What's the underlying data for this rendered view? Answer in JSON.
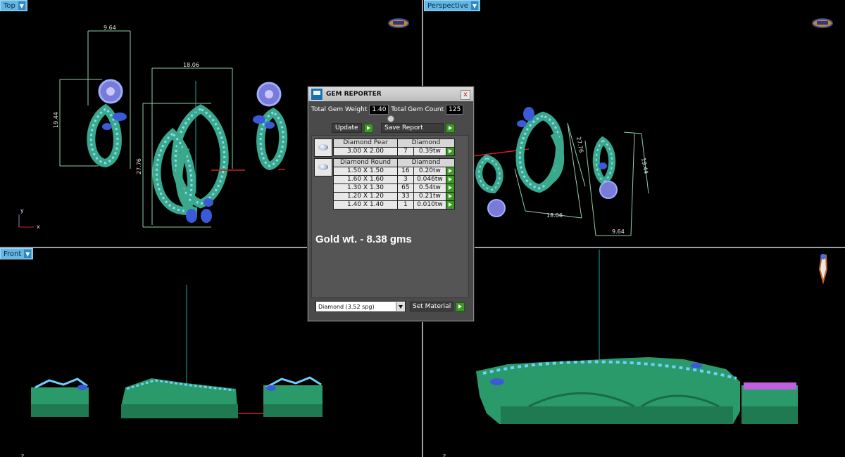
{
  "viewports": {
    "top": {
      "label": "Top",
      "dims": {
        "w1": "9.64",
        "h1": "19.44",
        "w2": "18.06",
        "h2": "27.76"
      },
      "axis_y": "y",
      "axis_x": "x"
    },
    "perspective": {
      "label": "Perspective",
      "dims": {
        "a": "27.76",
        "b": "19.44",
        "c": "18.06",
        "d": "9.64"
      }
    },
    "front": {
      "label": "Front",
      "axis_z": "z"
    },
    "right": {
      "axis_z": "z"
    }
  },
  "gem_reporter": {
    "title": "GEM REPORTER",
    "close": "x",
    "total_weight_label": "Total Gem Weight",
    "total_weight_value": "1.40",
    "total_count_label": "Total Gem Count",
    "total_count_value": "125",
    "update_label": "Update",
    "save_report_label": "Save Report",
    "pear_table": {
      "header_shape": "Diamond Pear",
      "header_material": "Diamond",
      "rows": [
        {
          "size": "3.00 X 2.00",
          "count": "7",
          "weight": "0.39tw"
        }
      ]
    },
    "round_table": {
      "header_shape": "Diamond Round",
      "header_material": "Diamond",
      "rows": [
        {
          "size": "1.50 X 1.50",
          "count": "16",
          "weight": "0.20tw"
        },
        {
          "size": "1.60 X 1.60",
          "count": "3",
          "weight": "0.046tw"
        },
        {
          "size": "1.30 X 1.30",
          "count": "65",
          "weight": "0.54tw"
        },
        {
          "size": "1.20 X 1.20",
          "count": "33",
          "weight": "0.21tw"
        },
        {
          "size": "1.40 X 1.40",
          "count": "1",
          "weight": "0.010tw"
        }
      ]
    },
    "gold_weight": "Gold wt. - 8.38 gms",
    "material_select": "Diamond      (3.52 spg)",
    "set_material_label": "Set Material"
  }
}
